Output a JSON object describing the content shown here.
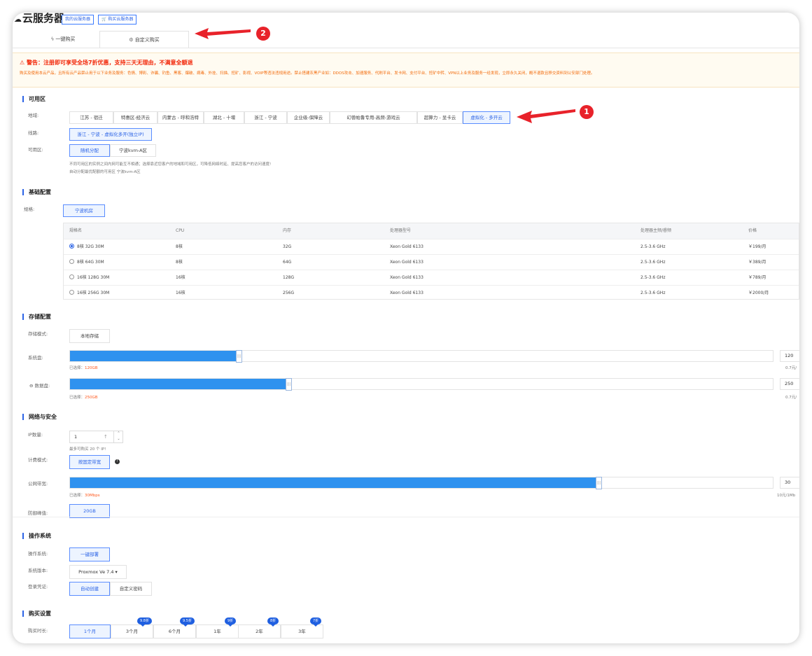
{
  "header": {
    "title": "云服务器",
    "btn_my": "我的云服务器",
    "btn_buy": "购买云服务器",
    "tabs": [
      {
        "label": "一键购买",
        "icon": "bolt-icon"
      },
      {
        "label": "自定义购买",
        "icon": "settings-icon"
      }
    ]
  },
  "warning": {
    "title": "⚠ 警告：注册即可享受全场7折优惠，支持三天无理由，不满意全额退",
    "body": "购买及使用本云产品，且所有云产品禁止用于以下业务及服务：色情、博彩、诈骗、钓鱼、黑客、爆破、病毒、外挂、扫描、挖矿、影视、VOIP等违法违规用途。禁止搭建灰黑产业如：DDOS攻击、加速服务、代刷平台、发卡网、支付平台、挖矿中转、VPN以上业务及服务一经发现，立即永久关闭，概不退款且移交资料到公安部门处理。"
  },
  "availability": {
    "section": "可用区",
    "region_label": "地域:",
    "regions": [
      "江苏 - 宿迁",
      "特惠区-经济云",
      "内蒙古 - 呼和浩特",
      "湖北 - 十堰",
      "浙江 - 宁波",
      "企业级-保障云",
      "幻兽帕鲁专用-高频-游戏云",
      "超算力 - 显卡云",
      "虚拟化 - 多开云"
    ],
    "line_label": "线路:",
    "line": "浙江 - 宁波 - 虚拟化多开(独立IP)",
    "zone_label": "可用区:",
    "zones": [
      "随机分配",
      "宁波kvm-A区"
    ],
    "note1": "不同可用区的实例之间内网可能互不相通；选择靠近您客户的地域和可用区，可降低网络时延、提高您客户的访问速度!",
    "note2": "自动分配最优配额的可用区 宁波kvm-A区"
  },
  "basic": {
    "section": "基础配置",
    "spec_label": "规格:",
    "room": "宁波机房",
    "columns": [
      "规格名",
      "CPU",
      "内存",
      "处理器型号",
      "处理器主频/睿频",
      "价格"
    ],
    "rows": [
      [
        "8核 32G 30M",
        "8核",
        "32G",
        "Xeon Gold 6133",
        "2.5-3.6 GHz",
        "￥199/月"
      ],
      [
        "8核 64G 30M",
        "8核",
        "64G",
        "Xeon Gold 6133",
        "2.5-3.6 GHz",
        "￥389/月"
      ],
      [
        "16核 128G 30M",
        "16核",
        "128G",
        "Xeon Gold 6133",
        "2.5-3.6 GHz",
        "￥789/月"
      ],
      [
        "16核 256G 30M",
        "16核",
        "256G",
        "Xeon Gold 6133",
        "2.5-3.6 GHz",
        "￥2000/月"
      ]
    ],
    "selected_row": 0
  },
  "storage": {
    "section": "存储配置",
    "mode_label": "存储模式:",
    "mode": "本地存储",
    "sys_label": "系统盘:",
    "sys_value": "120",
    "sys_fraction": 0.24,
    "sys_selected_prefix": "已选择：",
    "sys_selected": "120GB",
    "sys_price": "0.7元/",
    "data_label": "数据盘:",
    "data_value": "250",
    "data_fraction": 0.31,
    "data_selected_prefix": "已选择：",
    "data_selected": "250GB",
    "data_price": "0.7元/"
  },
  "network": {
    "section": "网络与安全",
    "ip_label": "IP数量:",
    "ip_value": "1",
    "ip_note": "最多可购买 20 个 IP!",
    "billing_label": "计费模式:",
    "billing": "按固定带宽",
    "bw_label": "公网带宽:",
    "bw_value": "30",
    "bw_fraction": 0.75,
    "bw_selected_prefix": "已选择：",
    "bw_selected": "30Mbps",
    "bw_price": "10元/1Mb",
    "ddos_label": "防御峰值:",
    "ddos": "20GB"
  },
  "os": {
    "section": "操作系统",
    "os_label": "操作系统:",
    "os_btn": "一键部署",
    "version_label": "系统版本:",
    "version": "Proxmox Ve 7.4",
    "cred_label": "登录凭证:",
    "creds": [
      "自动创建",
      "自定义密码"
    ]
  },
  "purchase": {
    "section": "购买设置",
    "duration_label": "购买时长:",
    "durations": [
      "1个月",
      "3个月",
      "6个月",
      "1年",
      "2年",
      "3年"
    ],
    "badges": [
      "9.8折",
      "9.5折",
      "9折",
      "8折",
      "7折"
    ]
  },
  "annotations": {
    "one": "1",
    "two": "2"
  },
  "colors": {
    "accent": "#2b63e6",
    "arrow": "#e8222a",
    "slider": "#2f92ef",
    "warn": "#f2280a"
  }
}
